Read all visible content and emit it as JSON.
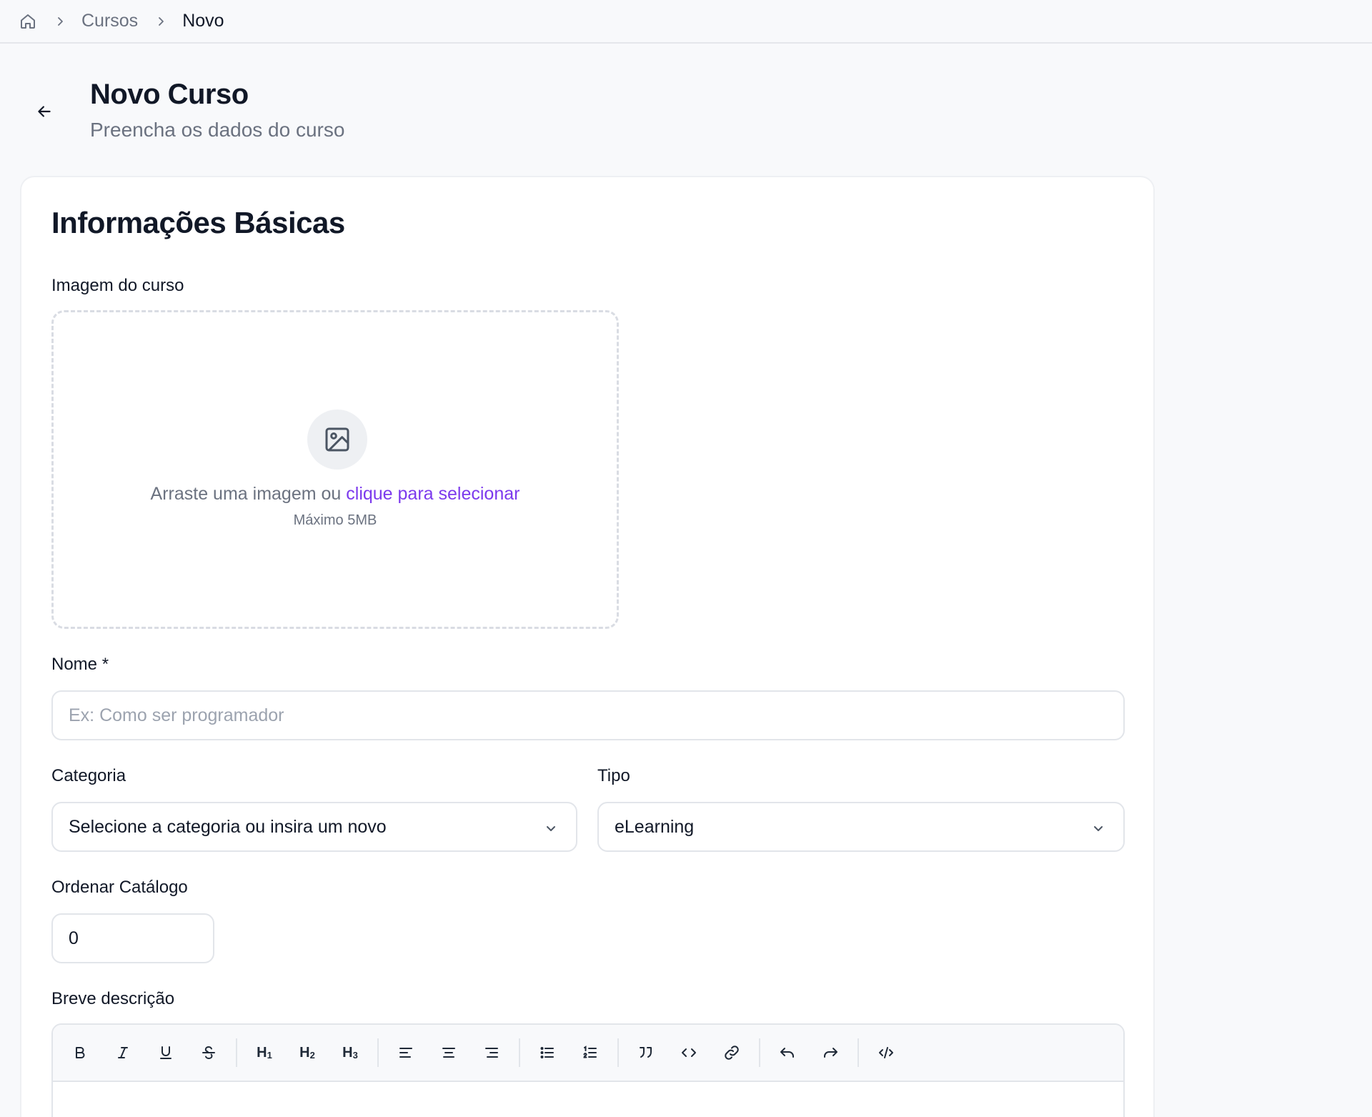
{
  "breadcrumb": {
    "home_icon": "home-icon",
    "items": [
      "Cursos",
      "Novo"
    ]
  },
  "header": {
    "back_icon": "arrow-left-icon",
    "title": "Novo Curso",
    "subtitle": "Preencha os dados do curso"
  },
  "form": {
    "section_title": "Informações Básicas",
    "image": {
      "label": "Imagem do curso",
      "icon": "image-icon",
      "prompt": "Arraste uma imagem ou",
      "link": "clique para selecionar",
      "hint": "Máximo 5MB"
    },
    "name": {
      "label": "Nome *",
      "placeholder": "Ex: Como ser programador",
      "value": ""
    },
    "category": {
      "label": "Categoria",
      "value": "Selecione a categoria ou insira um novo"
    },
    "type": {
      "label": "Tipo",
      "value": "eLearning"
    },
    "order": {
      "label": "Ordenar Catálogo",
      "value": "0"
    },
    "description": {
      "label": "Breve descrição",
      "toolbar": {
        "h1": "H",
        "h2": "H",
        "h3": "H",
        "h1_sub": "1",
        "h2_sub": "2",
        "h3_sub": "3"
      }
    }
  },
  "colors": {
    "accent": "#7c3aed",
    "background": "#f8f9fb",
    "card": "#ffffff",
    "border": "#e2e5ea",
    "muted_text": "#6b7280"
  }
}
